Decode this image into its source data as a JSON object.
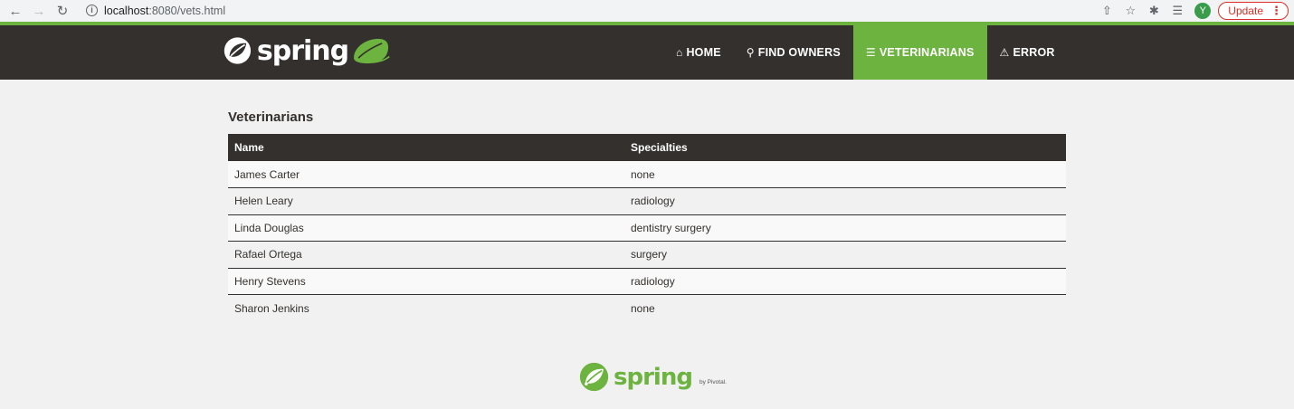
{
  "browser": {
    "url_host": "localhost",
    "url_path": ":8080/vets.html",
    "avatar_letter": "Y",
    "update_label": "Update"
  },
  "navbar": {
    "brand": "spring",
    "items": [
      {
        "label": "HOME",
        "icon": "home-icon"
      },
      {
        "label": "FIND OWNERS",
        "icon": "search-icon"
      },
      {
        "label": "VETERINARIANS",
        "icon": "list-icon",
        "active": true
      },
      {
        "label": "ERROR",
        "icon": "warning-icon"
      }
    ]
  },
  "main": {
    "title": "Veterinarians",
    "columns": [
      "Name",
      "Specialties"
    ],
    "rows": [
      {
        "name": "James Carter",
        "specialties": "none"
      },
      {
        "name": "Helen Leary",
        "specialties": "radiology"
      },
      {
        "name": "Linda Douglas",
        "specialties": "dentistry surgery"
      },
      {
        "name": "Rafael Ortega",
        "specialties": "surgery"
      },
      {
        "name": "Henry Stevens",
        "specialties": "radiology"
      },
      {
        "name": "Sharon Jenkins",
        "specialties": "none"
      }
    ]
  },
  "footer": {
    "brand": "spring",
    "by": "by Pivotal."
  },
  "colors": {
    "accent": "#6db33f",
    "dark": "#34302d",
    "background": "#f1f1f1"
  }
}
